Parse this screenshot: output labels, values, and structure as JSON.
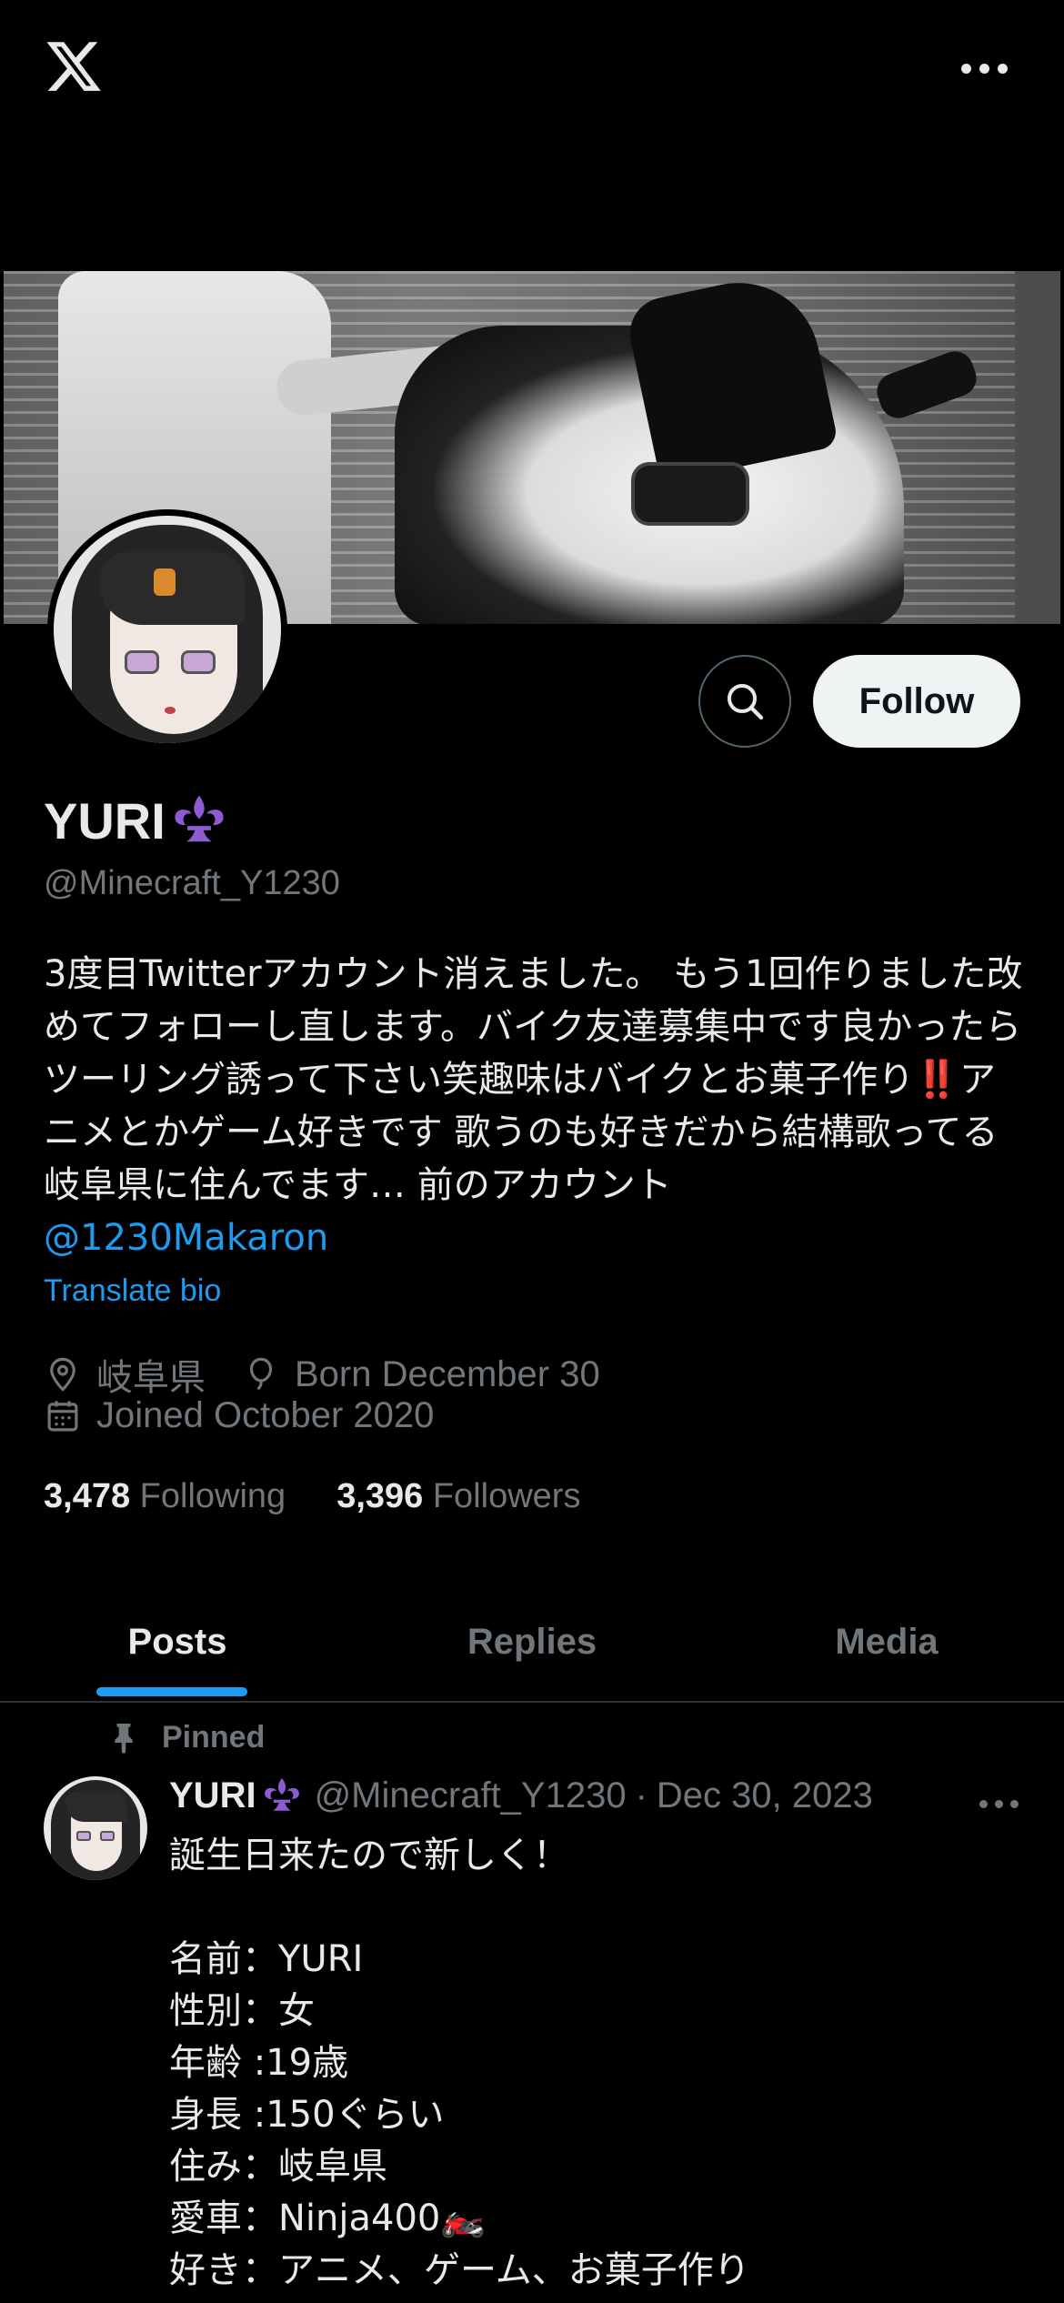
{
  "header": {
    "logo_icon": "x-logo-icon",
    "more_icon": "more-horizontal-icon"
  },
  "profile": {
    "display_name": "YURI",
    "name_emoji": "fleur-de-lis-icon",
    "handle": "@Minecraft_Y1230",
    "bio_text": "3度目Twitterアカウント消えました。 もう1回作りました改めてフォローし直します。バイク友達募集中です良かったらツーリング誘って下さい笑趣味はバイクとお菓子作り‼️アニメとかゲーム好きです 歌うのも好きだから結構歌ってる 岐阜県に住んでます… 前のアカウント ",
    "bio_mention": "@1230Makaron",
    "translate_label": "Translate bio",
    "location": "岐阜県",
    "birthday": "Born December 30",
    "joined": "Joined October 2020",
    "following_count": "3,478",
    "following_label": "Following",
    "followers_count": "3,396",
    "followers_label": "Followers"
  },
  "actions": {
    "follow_label": "Follow",
    "search_icon": "search-icon"
  },
  "tabs": [
    {
      "label": "Posts",
      "active": true
    },
    {
      "label": "Replies",
      "active": false
    },
    {
      "label": "Media",
      "active": false
    }
  ],
  "pinned_post": {
    "pinned_label": "Pinned",
    "author_name": "YURI",
    "author_handle": "@Minecraft_Y1230",
    "separator": "·",
    "date": "Dec 30, 2023",
    "body": "誕生日来たので新しく！\n\n名前：YURI\n性別：女\n年齢 :19歳\n身長 :150ぐらい\n住み：岐阜県\n愛車：Ninja400🏍️\n好き：アニメ、ゲーム、お菓子作り"
  },
  "colors": {
    "accent": "#1d9bf0",
    "muted": "#71767b",
    "text": "#e7e9ea",
    "background": "#000000",
    "divider": "#2f3336"
  }
}
